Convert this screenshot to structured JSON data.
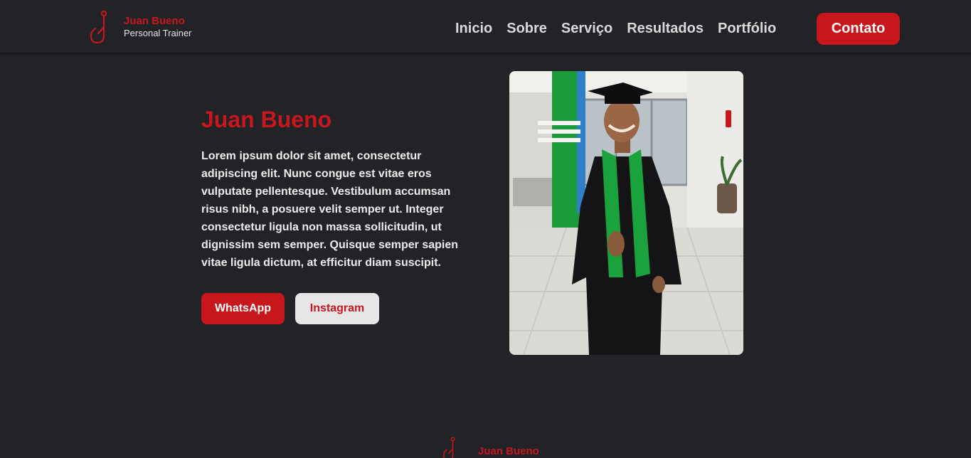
{
  "header": {
    "brand_name": "Juan Bueno",
    "brand_subtitle": "Personal Trainer",
    "nav": [
      "Inicio",
      "Sobre",
      "Serviço",
      "Resultados",
      "Portfólio"
    ],
    "contact_label": "Contato"
  },
  "hero": {
    "title": "Juan Bueno",
    "text": "Lorem ipsum dolor sit amet, consectetur adipiscing elit. Nunc congue est vitae eros vulputate pellentesque. Vestibulum accumsan risus nibh, a posuere velit semper ut. Integer consectetur ligula non massa sollicitudin, ut dignissim sem semper. Quisque semper sapien vitae ligula dictum, at efficitur diam suscipit.",
    "whatsapp_label": "WhatsApp",
    "instagram_label": "Instagram"
  },
  "footer": {
    "brand_name": "Juan Bueno"
  },
  "colors": {
    "background": "#222327",
    "accent": "#c8161d",
    "light_button": "#e6e6e6"
  },
  "icons": {
    "logo": "j-logo-icon"
  }
}
